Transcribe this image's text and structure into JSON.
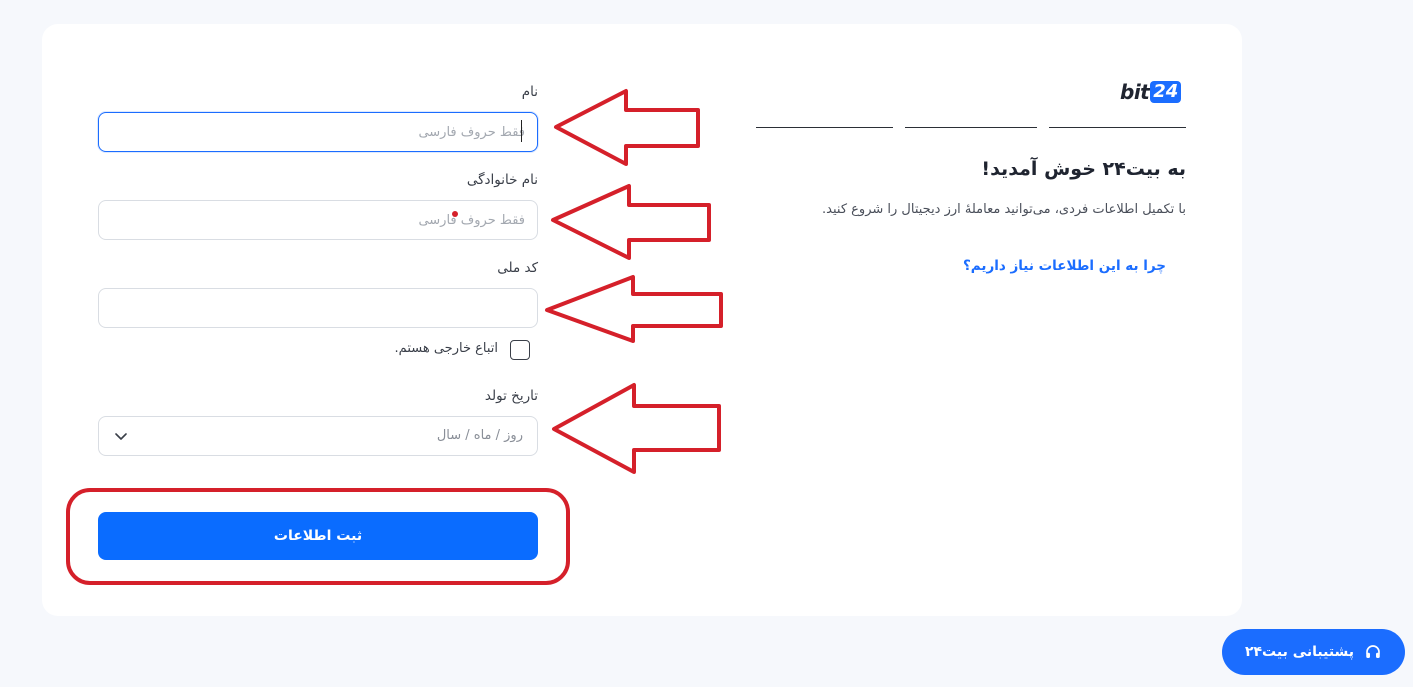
{
  "brand": {
    "logo_text": "bit",
    "logo_number": "24",
    "accent": "#1b6dff"
  },
  "intro": {
    "title": "به بیت۲۴ خوش آمدید!",
    "subtitle": "با تکمیل اطلاعات فردی، می‌توانید معاملهٔ ارز دیجیتال را شروع کنید.",
    "why_link": "چرا به این اطلاعات نیاز داریم؟"
  },
  "form": {
    "first_name": {
      "label": "نام",
      "placeholder": "فقط حروف فارسی",
      "value": ""
    },
    "last_name": {
      "label": "نام خانوادگی",
      "placeholder": "فقط حروف فارسی",
      "value": ""
    },
    "national_code": {
      "label": "کد ملی",
      "placeholder": "",
      "value": ""
    },
    "foreign_national": {
      "label": "اتباع خارجی هستم.",
      "checked": false
    },
    "birth_date": {
      "label": "تاریخ تولد",
      "placeholder": "روز / ماه / سال"
    },
    "submit_label": "ثبت اطلاعات"
  },
  "support": {
    "label": "پشتیبانی بیت۲۴",
    "icon": "headset-icon"
  },
  "annotations": {
    "color": "#d5202a"
  }
}
